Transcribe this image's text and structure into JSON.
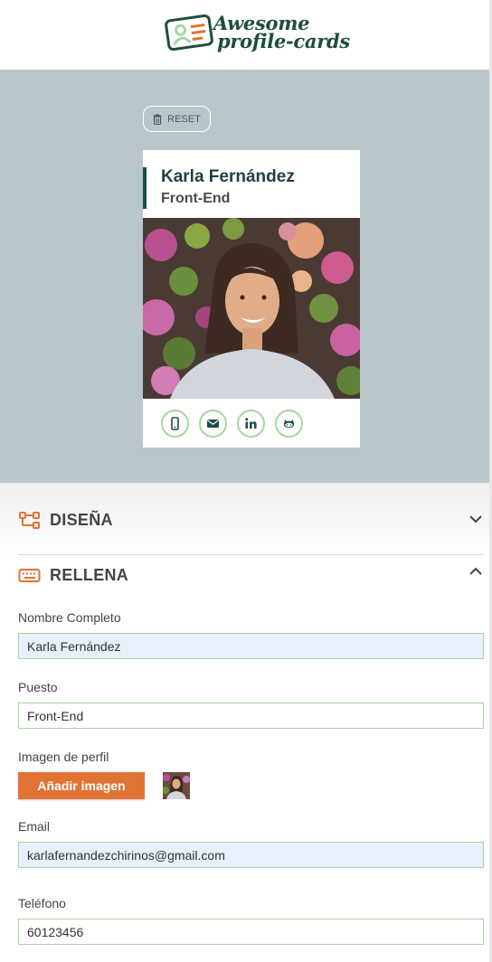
{
  "header": {
    "logo_line1": "Awesome",
    "logo_line2": "profile-cards",
    "logo_icon": "id-card-icon"
  },
  "preview": {
    "reset_label": "RESET",
    "reset_icon": "trash-icon",
    "card": {
      "name": "Karla Fernández",
      "job": "Front-End",
      "social": [
        {
          "icon": "mobile-phone-icon"
        },
        {
          "icon": "envelope-icon"
        },
        {
          "icon": "linkedin-icon"
        },
        {
          "icon": "github-icon"
        }
      ]
    }
  },
  "sections": {
    "design": {
      "label": "DISEÑA",
      "icon": "palette-icon",
      "chevron": "chevron-down-icon"
    },
    "fill": {
      "label": "RELLENA",
      "icon": "keyboard-icon",
      "chevron": "chevron-up-icon"
    }
  },
  "form": {
    "full_name": {
      "label": "Nombre Completo",
      "value": "Karla Fernández"
    },
    "job": {
      "label": "Puesto",
      "value": "Front-End"
    },
    "image": {
      "label": "Imagen de perfil",
      "button": "Añadir imagen"
    },
    "email": {
      "label": "Email",
      "value": "karlafernandezchirinos@gmail.com"
    },
    "phone": {
      "label": "Teléfono",
      "value": "60123456"
    }
  },
  "colors": {
    "brand_dark": "#1d4d47",
    "accent_orange": "#e17334",
    "field_border": "#a8d5a2",
    "preview_bg": "#b9c7ca"
  }
}
